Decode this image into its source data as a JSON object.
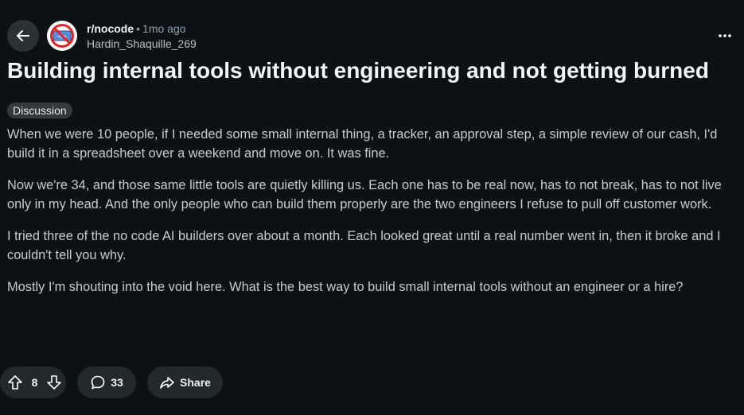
{
  "header": {
    "subreddit": "r/nocode",
    "separator": "•",
    "time_ago": "1mo ago",
    "author": "Hardin_Shaquille_269"
  },
  "post": {
    "title": "Building internal tools without engineering and not getting burned",
    "flair": "Discussion",
    "paragraphs": [
      "When we were 10 people, if I needed some small internal thing, a tracker, an approval step, a simple review of our cash, I'd build it in a spreadsheet over a weekend and move on. It was fine.",
      "Now we're 34, and those same little tools are quietly killing us. Each one has to be real now, has to not break, has to not live only in my head. And the only people who can build them properly are the two engineers I refuse to pull off customer work.",
      "I tried three of the no code AI builders over about a month. Each looked great until a real number went in, then it broke and I couldn't tell you why.",
      "Mostly I'm shouting into the void here. What is the best way to build small internal tools without an engineer or a hire?"
    ]
  },
  "actions": {
    "votes": "8",
    "comments": "33",
    "share_label": "Share"
  },
  "icons": {
    "back": "arrow-left-icon",
    "more": "ellipsis-icon",
    "upvote": "arrow-up-icon",
    "downvote": "arrow-down-icon",
    "comment": "speech-bubble-icon",
    "share": "share-arrow-icon"
  },
  "colors": {
    "background": "#0e1113",
    "pill": "#22292d",
    "flair": "#33393d",
    "text": "#c5ccd0",
    "title": "#f2f4f5"
  }
}
